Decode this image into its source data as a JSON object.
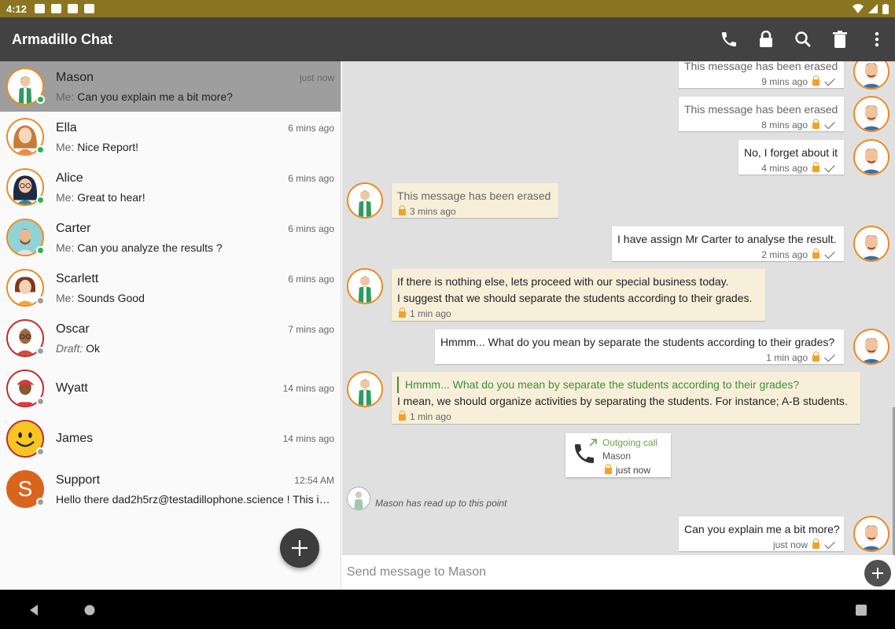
{
  "status_bar": {
    "time": "4:12"
  },
  "app": {
    "title": "Armadillo Chat"
  },
  "toolbar": {
    "icons": [
      "phone-icon",
      "lock-icon",
      "search-icon",
      "trash-icon",
      "more-vert-icon"
    ]
  },
  "conversations": [
    {
      "name": "Mason",
      "time": "just now",
      "prefix": "Me:",
      "preview": "Can you explain me a bit more?",
      "status": "online",
      "selected": true
    },
    {
      "name": "Ella",
      "time": "6 mins ago",
      "prefix": "Me:",
      "preview": "Nice Report!",
      "status": "online"
    },
    {
      "name": "Alice",
      "time": "6 mins ago",
      "prefix": "Me:",
      "preview": "Great to hear!",
      "status": "online"
    },
    {
      "name": "Carter",
      "time": "6 mins ago",
      "prefix": "Me:",
      "preview": "Can you analyze the results ?",
      "status": "online"
    },
    {
      "name": "Scarlett",
      "time": "6 mins ago",
      "prefix": "Me:",
      "preview": "Sounds Good",
      "status": "offline"
    },
    {
      "name": "Oscar",
      "time": "7 mins ago",
      "prefix": "Draft:",
      "preview": "Ok",
      "status": "offline",
      "draft": true
    },
    {
      "name": "Wyatt",
      "time": "14 mins ago",
      "prefix": "",
      "preview": "",
      "status": "offline"
    },
    {
      "name": "James",
      "time": "14 mins ago",
      "prefix": "",
      "preview": "",
      "status": "offline"
    },
    {
      "name": "Support",
      "time": "12:54 AM",
      "prefix": "",
      "preview": "Hello there dad2h5rz@testadillophone.science ! This i…",
      "status": "offline",
      "initial": "S"
    }
  ],
  "messages": [
    {
      "dir": "out",
      "text": "This message has been erased",
      "time": "9 mins ago",
      "erased": true
    },
    {
      "dir": "out",
      "text": "This message has been erased",
      "time": "8 mins ago",
      "erased": true
    },
    {
      "dir": "out",
      "text": "No, I forget about it",
      "time": "4 mins ago"
    },
    {
      "dir": "in",
      "text": "This message has been erased",
      "time": "3 mins ago",
      "erased": true
    },
    {
      "dir": "out",
      "text": "I have assign Mr Carter to analyse the result.",
      "time": "2 mins ago"
    },
    {
      "dir": "in",
      "text": "If there is nothing else, lets proceed with our special business today.",
      "text2": "I suggest that we should separate the students according to their grades.",
      "time": "1 min ago"
    },
    {
      "dir": "out",
      "text": "Hmmm... What do you mean by separate the students according to their grades?",
      "time": "1 min ago"
    },
    {
      "dir": "in",
      "reply": "Hmmm... What do you mean by separate the students according to their grades?",
      "text": "I mean, we should organize activities by separating the students. For instance; A-B students.",
      "time": "1 min ago"
    },
    {
      "dir": "out",
      "text": "Can you explain me a bit more?",
      "time": "just now"
    }
  ],
  "call": {
    "title": "Outgoing call",
    "name": "Mason",
    "time": "just now"
  },
  "read_receipt": "Mason has read up to this point",
  "composer": {
    "placeholder": "Send message to Mason"
  },
  "colors": {
    "status_bar": "#8c7520",
    "toolbar": "#424242",
    "accent_orange": "#ef8a1f",
    "online": "#2bb24c",
    "incoming_bubble": "#f7efd9",
    "reply_green": "#3d8f3a"
  }
}
